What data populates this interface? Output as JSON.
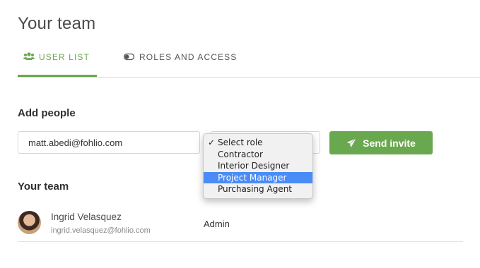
{
  "page": {
    "title": "Your team"
  },
  "tabs": [
    {
      "label": "USER LIST",
      "icon": "users-icon",
      "active": true
    },
    {
      "label": "ROLES AND ACCESS",
      "icon": "toggle-icon",
      "active": false
    }
  ],
  "add_people": {
    "heading": "Add people",
    "email_value": "matt.abedi@fohlio.com",
    "role_select": {
      "selected": "Select role",
      "options": [
        "Select role",
        "Contractor",
        "Interior Designer",
        "Project Manager",
        "Purchasing Agent"
      ],
      "highlighted": "Project Manager"
    },
    "send_button": "Send invite"
  },
  "team": {
    "heading": "Your team",
    "members": [
      {
        "name": "Ingrid Velasquez",
        "email": "ingrid.velasquez@fohlio.com",
        "role": "Admin"
      }
    ]
  },
  "colors": {
    "accent": "#6aa84f",
    "highlight": "#4a8cf7"
  }
}
